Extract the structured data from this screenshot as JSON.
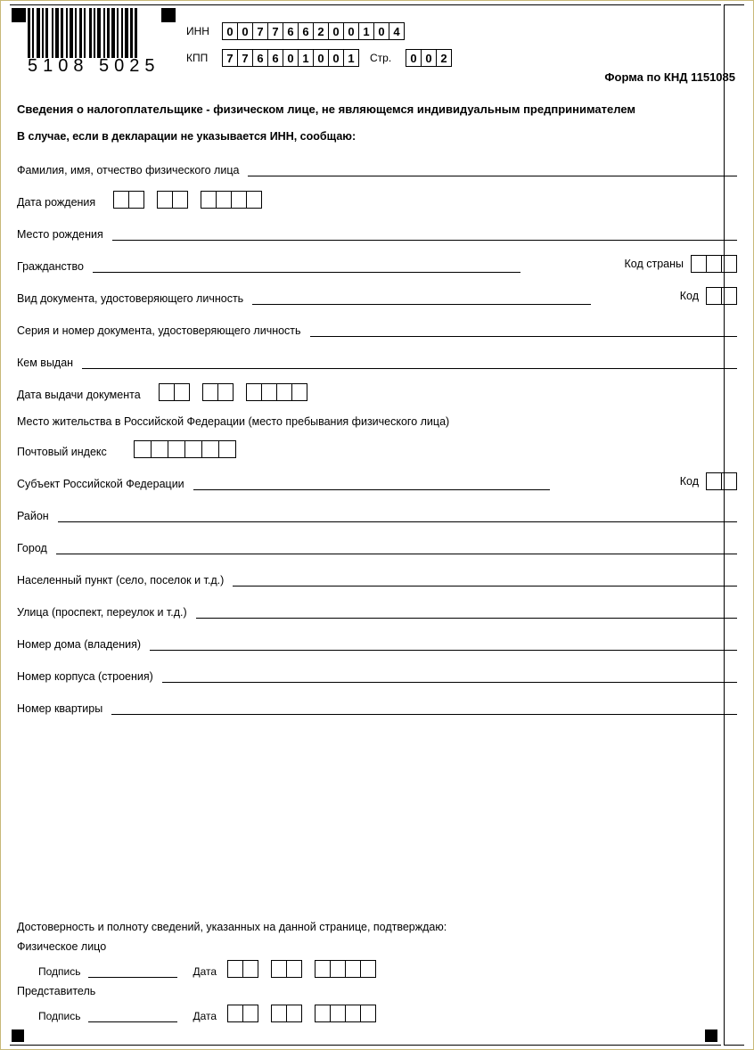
{
  "barcode_digits": "5108 5025",
  "header": {
    "inn_label": "ИНН",
    "inn": [
      "0",
      "0",
      "7",
      "7",
      "6",
      "6",
      "2",
      "0",
      "0",
      "1",
      "0",
      "4"
    ],
    "kpp_label": "КПП",
    "kpp": [
      "7",
      "7",
      "6",
      "6",
      "0",
      "1",
      "0",
      "0",
      "1"
    ],
    "page_label": "Стр.",
    "page": [
      "0",
      "0",
      "2"
    ],
    "form_code": "Форма по КНД 1151085"
  },
  "title": "Сведения о налогоплательщике - физическом лице, не являющемся индивидуальным предпринимателем",
  "subtitle": "В случае, если в декларации не указывается ИНН, сообщаю:",
  "fields": {
    "fio": "Фамилия, имя, отчество физического лица",
    "birth_date": "Дата рождения",
    "birth_place": "Место рождения",
    "citizenship": "Гражданство",
    "country_code": "Код страны",
    "doc_type": "Вид документа, удостоверяющего личность",
    "code": "Код",
    "doc_series": "Серия и номер документа, удостоверяющего личность",
    "issued_by": "Кем выдан",
    "issue_date": "Дата выдачи документа",
    "residence": "Место жительства в Российской Федерации (место пребывания физического лица)",
    "postal": "Почтовый индекс",
    "subject": "Субъект Российской Федерации",
    "district": "Район",
    "city": "Город",
    "settlement": "Населенный пункт (село, поселок и т.д.)",
    "street": "Улица (проспект, переулок и т.д.)",
    "house": "Номер дома (владения)",
    "building": "Номер корпуса (строения)",
    "apartment": "Номер квартиры"
  },
  "sig": {
    "confirm": "Достоверность и полноту сведений, указанных на данной странице, подтверждаю:",
    "individual": "Физическое лицо",
    "representative": "Представитель",
    "signature": "Подпись",
    "date": "Дата"
  }
}
